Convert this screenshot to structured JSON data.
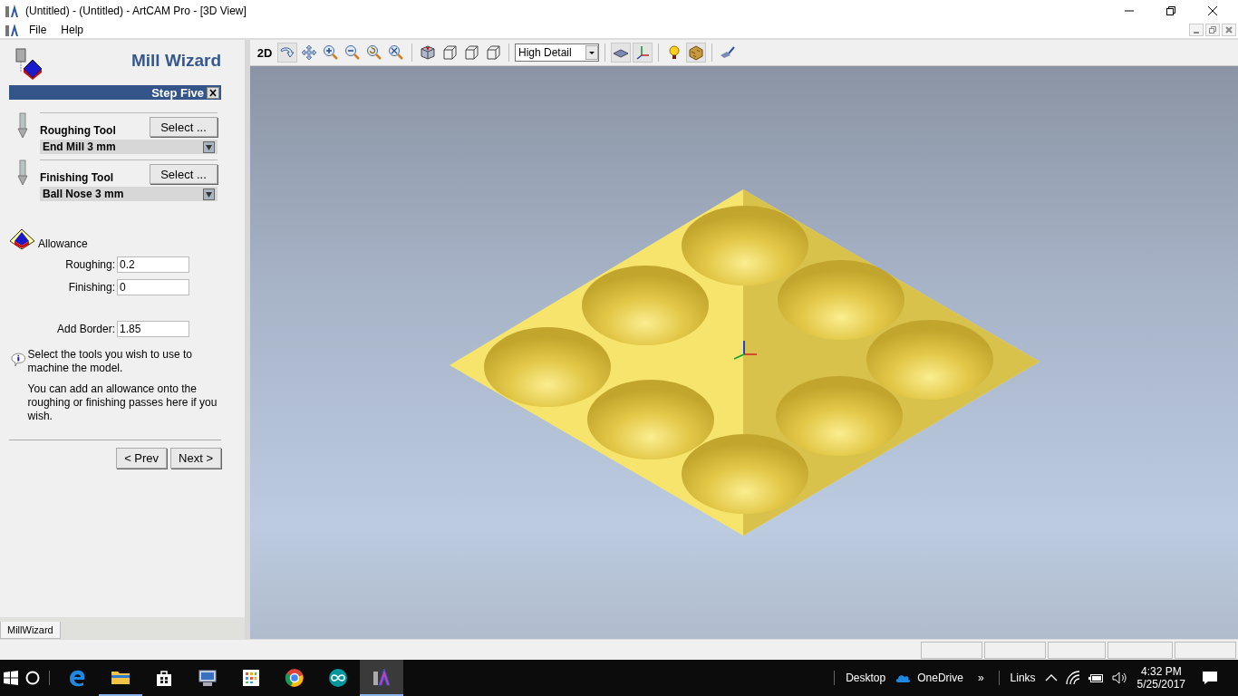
{
  "window": {
    "title": "(Untitled) - (Untitled) - ArtCAM Pro - [3D View]"
  },
  "menu": [
    "File",
    "Help"
  ],
  "wizard": {
    "title": "Mill Wizard",
    "step": "Step Five",
    "tools": [
      {
        "label": "Roughing Tool",
        "button": "Select ...",
        "value": "End Mill 3 mm"
      },
      {
        "label": "Finishing Tool",
        "button": "Select ...",
        "value": "Ball Nose 3 mm"
      }
    ],
    "allowance": {
      "label": "Allowance",
      "fields": [
        {
          "label": "Roughing:",
          "value": "0.2"
        },
        {
          "label": "Finishing:",
          "value": "0"
        }
      ]
    },
    "border": {
      "label": "Add Border:",
      "value": "1.85"
    },
    "info": [
      "Select the tools you wish to use to machine the model.",
      "You can add an allowance onto the roughing or finishing passes here if you wish."
    ],
    "buttons": [
      "< Prev",
      "Next >"
    ]
  },
  "panel_tabs": [
    {
      "label": "MillWizard",
      "selected": true
    }
  ],
  "toolbar": [
    {
      "kind": "text",
      "label": "2D",
      "pressed": false
    },
    {
      "kind": "rotate",
      "pressed": true
    },
    {
      "kind": "pan",
      "pressed": false
    },
    {
      "kind": "zoom-in",
      "pressed": false
    },
    {
      "kind": "zoom-out",
      "pressed": false
    },
    {
      "kind": "zoom-back",
      "pressed": false
    },
    {
      "kind": "zoom-all",
      "pressed": false
    },
    {
      "kind": "separator"
    },
    {
      "kind": "cube-solid",
      "pressed": false
    },
    {
      "kind": "cube-wire",
      "pressed": false
    },
    {
      "kind": "cube-wire",
      "pressed": false
    },
    {
      "kind": "cube-wire",
      "pressed": false
    },
    {
      "kind": "separator"
    },
    {
      "kind": "dropdown",
      "value": "High Detail"
    },
    {
      "kind": "separator"
    },
    {
      "kind": "plane",
      "pressed": true
    },
    {
      "kind": "axes",
      "pressed": true
    },
    {
      "kind": "separator"
    },
    {
      "kind": "bulb",
      "pressed": false
    },
    {
      "kind": "texture",
      "pressed": true
    },
    {
      "kind": "separator"
    },
    {
      "kind": "brush",
      "pressed": false
    }
  ],
  "taskbar": {
    "apps": [
      {
        "kind": "edge",
        "running": false,
        "selected": false
      },
      {
        "kind": "folder",
        "running": true,
        "selected": false
      },
      {
        "kind": "store",
        "running": false,
        "selected": false
      },
      {
        "kind": "computer",
        "running": false,
        "selected": false
      },
      {
        "kind": "grid",
        "running": false,
        "selected": false
      },
      {
        "kind": "chrome",
        "running": false,
        "selected": false
      },
      {
        "kind": "infinity",
        "running": false,
        "selected": false
      },
      {
        "kind": "artcam",
        "running": true,
        "selected": true
      }
    ],
    "toolbars": [
      "Desktop",
      "OneDrive",
      "»",
      "Links"
    ],
    "time": "4:32 PM",
    "date": "5/25/2017"
  }
}
